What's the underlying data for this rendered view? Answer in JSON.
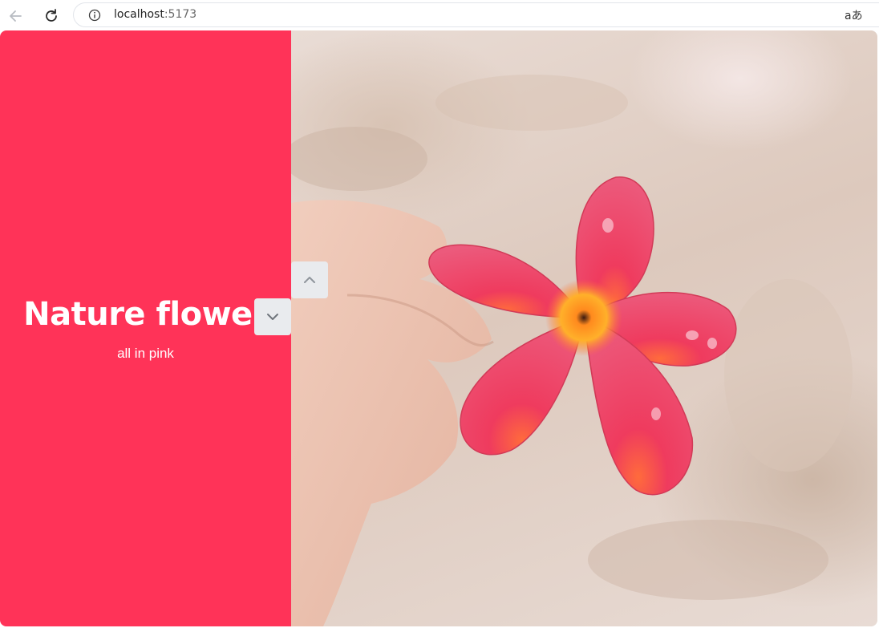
{
  "browser": {
    "url_host": "localhost",
    "url_port": ":5173",
    "translate_glyph": "aあ"
  },
  "hero": {
    "title": "Nature flower",
    "subtitle": "all in pink"
  },
  "icons": {
    "back": "arrow-left-icon",
    "reload": "reload-icon",
    "info": "info-icon",
    "translate": "translate-icon",
    "up": "chevron-up-icon",
    "down": "chevron-down-icon"
  },
  "colors": {
    "panel_bg": "#ff3358",
    "button_bg": "#e9ebee"
  }
}
